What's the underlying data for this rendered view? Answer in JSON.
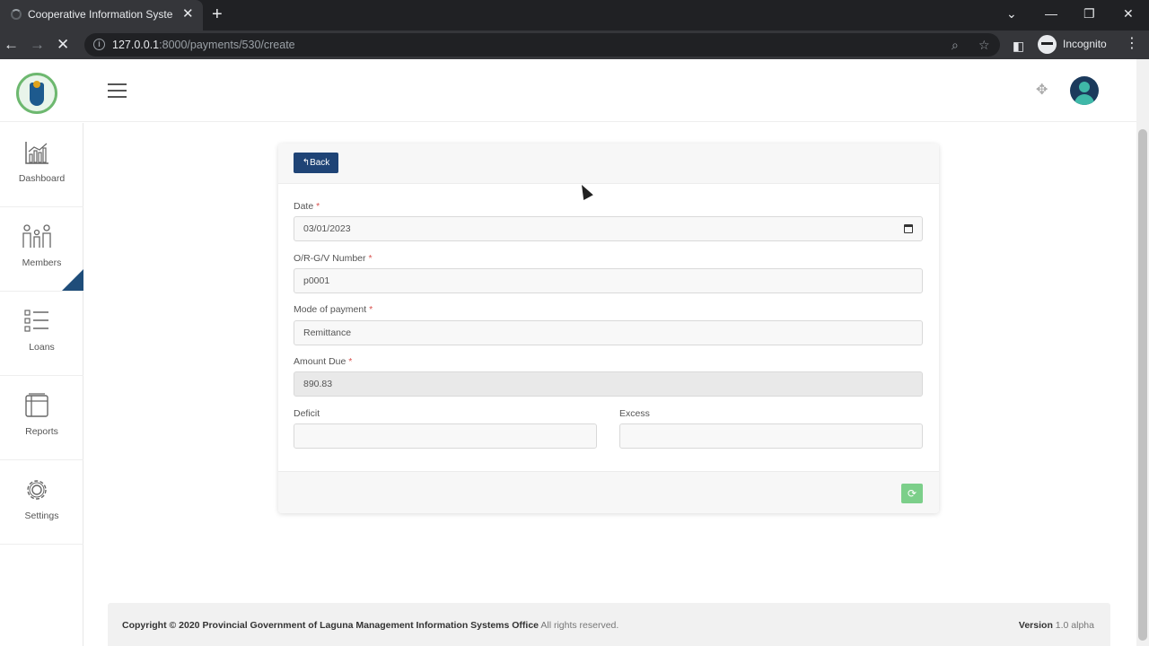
{
  "browser": {
    "tab_title": "Cooperative Information System",
    "url_host": "127.0.0.1",
    "url_path": ":8000/payments/530/create",
    "profile_label": "Incognito"
  },
  "sidebar": {
    "items": [
      {
        "label": "Dashboard",
        "icon": "chart-icon"
      },
      {
        "label": "Members",
        "icon": "members-icon"
      },
      {
        "label": "Loans",
        "icon": "checklist-icon"
      },
      {
        "label": "Reports",
        "icon": "reports-icon"
      },
      {
        "label": "Settings",
        "icon": "gear-icon"
      }
    ]
  },
  "form": {
    "back_label": "Back",
    "required_mark": "*",
    "date": {
      "label": "Date",
      "value": "03/01/2023"
    },
    "or_number": {
      "label": "O/R-G/V Number",
      "value": "p0001"
    },
    "mode": {
      "label": "Mode of payment",
      "value": "Remittance"
    },
    "amount_due": {
      "label": "Amount Due",
      "value": "890.83"
    },
    "deficit": {
      "label": "Deficit",
      "value": ""
    },
    "excess": {
      "label": "Excess",
      "value": ""
    }
  },
  "footer": {
    "copyright_prefix": "Copyright © 2020",
    "org": "Provincial Government of Laguna Management Information Systems Office",
    "rights": "All rights reserved.",
    "version_label": "Version",
    "version_value": "1.0 alpha"
  },
  "colors": {
    "primary": "#1f4476",
    "success": "#7ccf8a",
    "required": "#d9534f"
  }
}
